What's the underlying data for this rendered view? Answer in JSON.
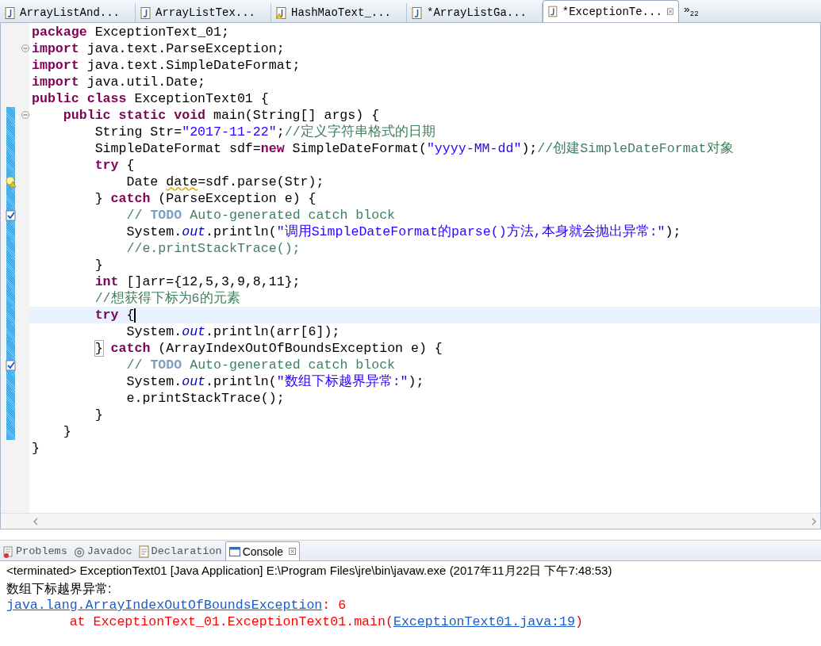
{
  "editor_tabs": [
    {
      "label": "ArrayListAnd...",
      "kind": "java",
      "selected": false
    },
    {
      "label": "ArrayListTex...",
      "kind": "java",
      "selected": false
    },
    {
      "label": "HashMaoText_...",
      "kind": "warning",
      "selected": false
    },
    {
      "label": "*ArrayListGa...",
      "kind": "java",
      "selected": false
    },
    {
      "label": "*ExceptionTe...",
      "kind": "java",
      "selected": true
    }
  ],
  "tab_overflow": {
    "symbol": "»",
    "count": "22"
  },
  "code_lines": [
    {
      "tokens": [
        {
          "kind": "keyword",
          "text": "package"
        },
        {
          "kind": "plain",
          "text": " ExceptionText_01;"
        }
      ],
      "fold": false,
      "changed": false,
      "current": false
    },
    {
      "tokens": [
        {
          "kind": "keyword",
          "text": "import"
        },
        {
          "kind": "plain",
          "text": " java.text.ParseException;"
        }
      ],
      "fold": true,
      "changed": false,
      "current": false
    },
    {
      "tokens": [
        {
          "kind": "keyword",
          "text": "import"
        },
        {
          "kind": "plain",
          "text": " java.text.SimpleDateFormat;"
        }
      ],
      "fold": false,
      "changed": false,
      "current": false
    },
    {
      "tokens": [
        {
          "kind": "keyword",
          "text": "import"
        },
        {
          "kind": "plain",
          "text": " java.util.Date;"
        }
      ],
      "fold": false,
      "changed": false,
      "current": false
    },
    {
      "tokens": [
        {
          "kind": "keyword",
          "text": "public class"
        },
        {
          "kind": "plain",
          "text": " ExceptionText01 {"
        }
      ],
      "fold": false,
      "changed": false,
      "current": false
    },
    {
      "tokens": [
        {
          "kind": "keyword",
          "text": "    public static void"
        },
        {
          "kind": "plain",
          "text": " main(String[] args) {"
        }
      ],
      "fold": true,
      "changed": true,
      "current": false
    },
    {
      "tokens": [
        {
          "kind": "plain",
          "text": "        String Str="
        },
        {
          "kind": "string",
          "text": "\"2017-11-22\""
        },
        {
          "kind": "plain",
          "text": ";"
        },
        {
          "kind": "comment",
          "text": "//定义字符串格式的日期"
        }
      ],
      "fold": false,
      "changed": true,
      "current": false
    },
    {
      "tokens": [
        {
          "kind": "plain",
          "text": "        SimpleDateFormat sdf="
        },
        {
          "kind": "keyword",
          "text": "new"
        },
        {
          "kind": "plain",
          "text": " SimpleDateFormat("
        },
        {
          "kind": "string",
          "text": "\"yyyy-MM-dd\""
        },
        {
          "kind": "plain",
          "text": ");"
        },
        {
          "kind": "comment",
          "text": "//创建SimpleDateFormat对象"
        }
      ],
      "fold": false,
      "changed": true,
      "current": false
    },
    {
      "tokens": [
        {
          "kind": "keyword",
          "text": "        try"
        },
        {
          "kind": "plain",
          "text": " {"
        }
      ],
      "fold": false,
      "changed": true,
      "current": false
    },
    {
      "tokens": [
        {
          "kind": "plain",
          "text": "            Date "
        },
        {
          "kind": "warning",
          "text": "date"
        },
        {
          "kind": "plain",
          "text": "=sdf.parse(Str);"
        }
      ],
      "fold": false,
      "changed": true,
      "current": false,
      "kind": "warning"
    },
    {
      "tokens": [
        {
          "kind": "plain",
          "text": "        } "
        },
        {
          "kind": "keyword",
          "text": "catch"
        },
        {
          "kind": "plain",
          "text": " (ParseException e) {"
        }
      ],
      "fold": false,
      "changed": true,
      "current": false
    },
    {
      "tokens": [
        {
          "kind": "comment",
          "text": "            // "
        },
        {
          "kind": "todo",
          "text": "TODO"
        },
        {
          "kind": "comment",
          "text": " Auto-generated catch block"
        }
      ],
      "fold": false,
      "changed": true,
      "current": false,
      "kind": "task"
    },
    {
      "tokens": [
        {
          "kind": "plain",
          "text": "            System."
        },
        {
          "kind": "field",
          "text": "out"
        },
        {
          "kind": "plain",
          "text": ".println("
        },
        {
          "kind": "string",
          "text": "\"调用SimpleDateFormat的parse()方法,本身就会抛出异常:\""
        },
        {
          "kind": "plain",
          "text": ");"
        }
      ],
      "fold": false,
      "changed": true,
      "current": false
    },
    {
      "tokens": [
        {
          "kind": "comment",
          "text": "            //e.printStackTrace();"
        }
      ],
      "fold": false,
      "changed": true,
      "current": false
    },
    {
      "tokens": [
        {
          "kind": "plain",
          "text": "        }"
        }
      ],
      "fold": false,
      "changed": true,
      "current": false
    },
    {
      "tokens": [
        {
          "kind": "keyword",
          "text": "        int"
        },
        {
          "kind": "plain",
          "text": " []arr={12,5,3,9,8,11};"
        }
      ],
      "fold": false,
      "changed": true,
      "current": false
    },
    {
      "tokens": [
        {
          "kind": "comment",
          "text": "        //想获得下标为6的元素"
        }
      ],
      "fold": false,
      "changed": true,
      "current": false
    },
    {
      "tokens": [
        {
          "kind": "keyword",
          "text": "        try"
        },
        {
          "kind": "plain",
          "text": " {"
        }
      ],
      "fold": false,
      "changed": true,
      "current": true
    },
    {
      "tokens": [
        {
          "kind": "plain",
          "text": "            System."
        },
        {
          "kind": "field",
          "text": "out"
        },
        {
          "kind": "plain",
          "text": ".println(arr[6]);"
        }
      ],
      "fold": false,
      "changed": true,
      "current": false
    },
    {
      "tokens": [
        {
          "kind": "bracket",
          "text": "        }"
        },
        {
          "kind": "keyword",
          "text": " catch"
        },
        {
          "kind": "plain",
          "text": " (ArrayIndexOutOfBoundsException e) {"
        }
      ],
      "fold": false,
      "changed": true,
      "current": false
    },
    {
      "tokens": [
        {
          "kind": "comment",
          "text": "            // "
        },
        {
          "kind": "todo",
          "text": "TODO"
        },
        {
          "kind": "comment",
          "text": " Auto-generated catch block"
        }
      ],
      "fold": false,
      "changed": true,
      "current": false,
      "kind": "task"
    },
    {
      "tokens": [
        {
          "kind": "plain",
          "text": "            System."
        },
        {
          "kind": "field",
          "text": "out"
        },
        {
          "kind": "plain",
          "text": ".println("
        },
        {
          "kind": "string",
          "text": "\"数组下标越界异常:\""
        },
        {
          "kind": "plain",
          "text": ");"
        }
      ],
      "fold": false,
      "changed": true,
      "current": false
    },
    {
      "tokens": [
        {
          "kind": "plain",
          "text": "            e.printStackTrace();"
        }
      ],
      "fold": false,
      "changed": true,
      "current": false
    },
    {
      "tokens": [
        {
          "kind": "plain",
          "text": "        }"
        }
      ],
      "fold": false,
      "changed": true,
      "current": false
    },
    {
      "tokens": [
        {
          "kind": "plain",
          "text": "    }"
        }
      ],
      "fold": false,
      "changed": true,
      "current": false
    },
    {
      "tokens": [
        {
          "kind": "plain",
          "text": "}"
        }
      ],
      "fold": false,
      "changed": false,
      "current": false
    }
  ],
  "view_tabs": [
    {
      "label": "Problems",
      "kind": "problems",
      "selected": false
    },
    {
      "label": "Javadoc",
      "kind": "javadoc",
      "selected": false
    },
    {
      "label": "Declaration",
      "kind": "declaration",
      "selected": false
    },
    {
      "label": "Console",
      "kind": "console",
      "selected": true
    }
  ],
  "console": {
    "header": "<terminated> ExceptionText01 [Java Application] E:\\Program Files\\jre\\bin\\javaw.exe (2017年11月22日 下午7:48:53)",
    "lines": [
      [
        {
          "kind": "out",
          "text": "数组下标越界异常:"
        }
      ],
      [
        {
          "kind": "link",
          "text": "java.lang.ArrayIndexOutOfBoundsException"
        },
        {
          "kind": "err",
          "text": ": 6"
        }
      ],
      [
        {
          "kind": "err",
          "text": "        at ExceptionText_01.ExceptionText01.main("
        },
        {
          "kind": "link",
          "text": "ExceptionText01.java:19"
        },
        {
          "kind": "err",
          "text": ")"
        }
      ]
    ]
  }
}
